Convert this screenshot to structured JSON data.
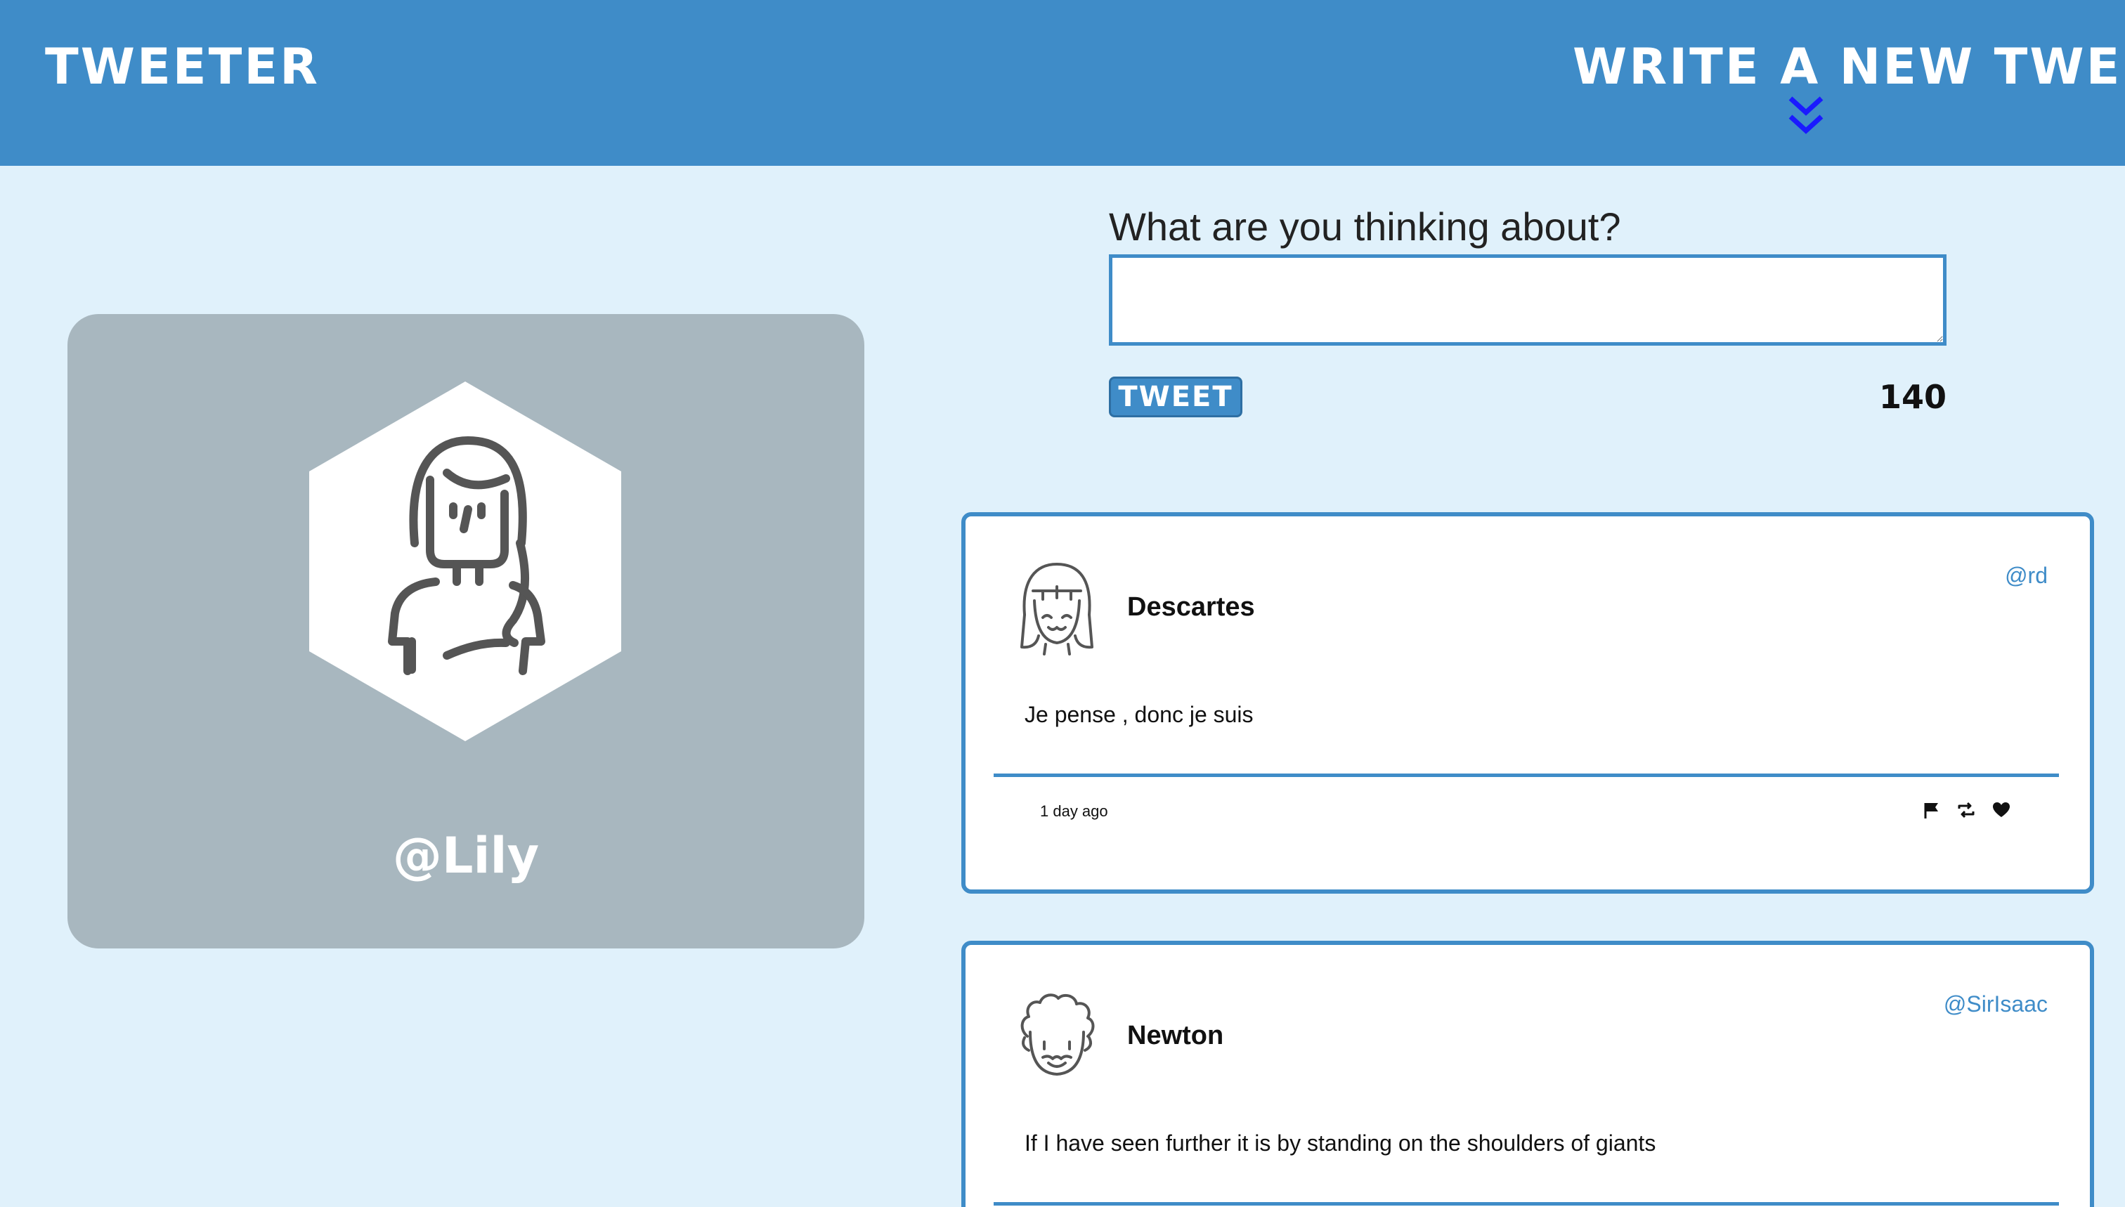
{
  "nav": {
    "brand": "TWEETER",
    "compose_label": "WRITE A NEW TWEET"
  },
  "profile": {
    "handle": "@Lily"
  },
  "composer": {
    "label": "What are you thinking about?",
    "value": "",
    "button_label": "TWEET",
    "counter": "140"
  },
  "tweets": [
    {
      "name": "Descartes",
      "handle": "@rd",
      "content": "Je pense , donc je suis",
      "time": "1 day ago"
    },
    {
      "name": "Newton",
      "handle": "@SirIsaac",
      "content": "If I have seen further it is by standing on the shoulders of giants"
    }
  ],
  "colors": {
    "nav_bg": "#3f8cc8",
    "page_bg": "#e0f1fb",
    "profile_card_bg": "#a8b7bf",
    "accent": "#3f8cc8",
    "chevron": "#1a1aff"
  },
  "icons": {
    "chevron": "chevron-double-down-icon",
    "flag": "flag-icon",
    "retweet": "retweet-icon",
    "like": "heart-icon"
  }
}
